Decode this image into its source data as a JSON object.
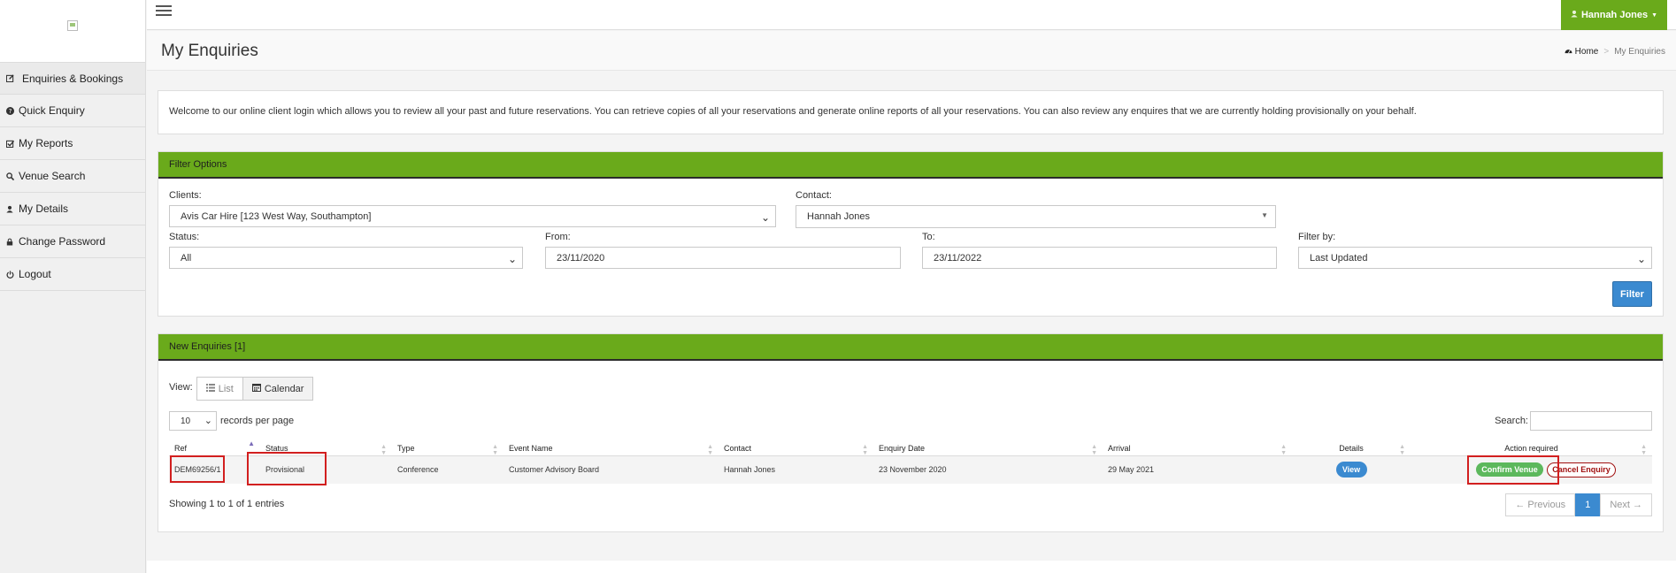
{
  "sidebar": {
    "items": [
      {
        "label": "Enquiries & Bookings",
        "icon": "edit-icon"
      },
      {
        "label": "Quick Enquiry",
        "icon": "question-icon"
      },
      {
        "label": "My Reports",
        "icon": "check-square-icon"
      },
      {
        "label": "Venue Search",
        "icon": "search-icon"
      },
      {
        "label": "My Details",
        "icon": "user-icon"
      },
      {
        "label": "Change Password",
        "icon": "lock-icon"
      },
      {
        "label": "Logout",
        "icon": "power-icon"
      }
    ]
  },
  "topbar": {
    "user_name": "Hannah Jones"
  },
  "header": {
    "title": "My Enquiries",
    "breadcrumb_home": "Home",
    "breadcrumb_sep": ">",
    "breadcrumb_current": "My Enquiries"
  },
  "welcome_text": "Welcome to our online client login which allows you to review all your past and future reservations. You can retrieve copies of all your reservations and generate online reports of all your reservations. You can also review any enquires that we are currently holding provisionally on your behalf.",
  "filter": {
    "title": "Filter Options",
    "clients_label": "Clients:",
    "clients_value": "Avis Car Hire [123 West Way, Southampton]",
    "contact_label": "Contact:",
    "contact_value": "Hannah Jones",
    "status_label": "Status:",
    "status_value": "All",
    "from_label": "From:",
    "from_value": "23/11/2020",
    "to_label": "To:",
    "to_value": "23/11/2022",
    "filter_by_label": "Filter by:",
    "filter_by_value": "Last Updated",
    "button_label": "Filter"
  },
  "enquiries": {
    "title": "New Enquiries [1]",
    "view_label": "View:",
    "list_label": "List",
    "calendar_label": "Calendar",
    "page_length": "10",
    "records_per_page": "records per page",
    "search_label": "Search:",
    "columns": [
      "Ref",
      "Status",
      "Type",
      "Event Name",
      "Contact",
      "Enquiry Date",
      "Arrival",
      "Details",
      "Action required"
    ],
    "rows": [
      {
        "ref": "DEM69256/1",
        "status": "Provisional",
        "type": "Conference",
        "event_name": "Customer Advisory Board",
        "contact": "Hannah Jones",
        "enquiry_date": "23 November 2020",
        "arrival": "29 May 2021",
        "details_button": "View",
        "confirm_button": "Confirm Venue",
        "cancel_button": "Cancel Enquiry"
      }
    ],
    "info": "Showing 1 to 1 of 1 entries",
    "prev_label": "← Previous",
    "current_page": "1",
    "next_label": "Next →"
  },
  "colors": {
    "brand_green": "#6aaa1b",
    "primary_blue": "#3b8ad0",
    "confirm_green": "#5cb85c",
    "highlight_red": "#d21f1f"
  }
}
